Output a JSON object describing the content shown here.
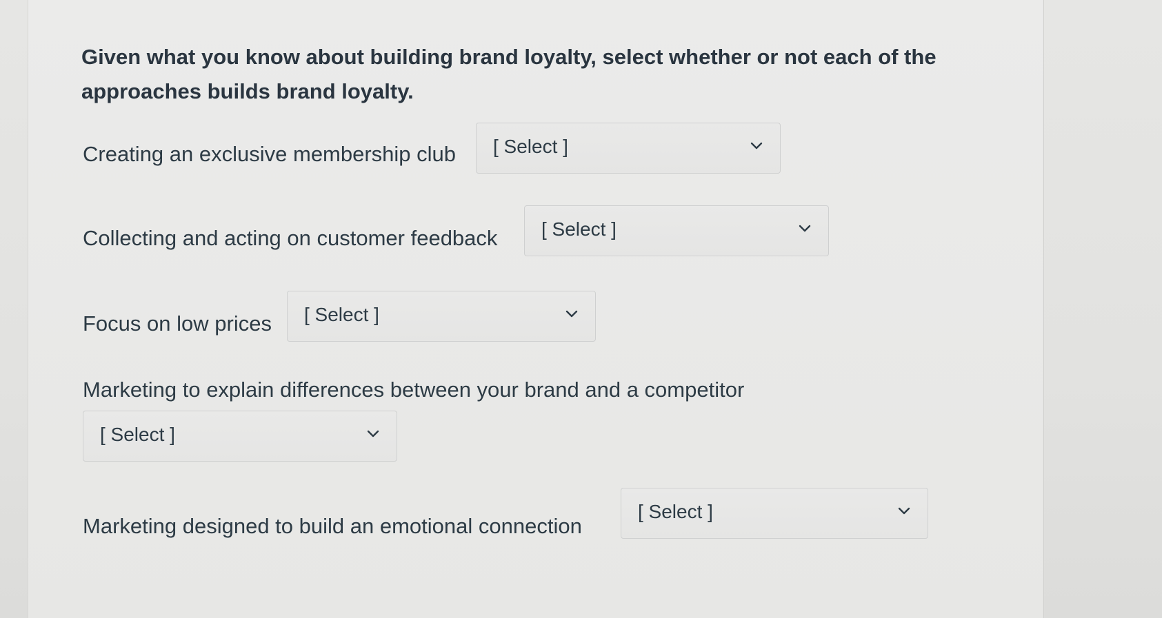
{
  "question": {
    "text": "Given what you know about building brand loyalty, select whether or not each of the approaches builds brand loyalty."
  },
  "items": [
    {
      "label": "Creating an exclusive membership club",
      "value": "[ Select ]"
    },
    {
      "label": "Collecting and acting on customer feedback",
      "value": "[ Select ]"
    },
    {
      "label": "Focus on low prices",
      "value": "[ Select ]"
    },
    {
      "label": "Marketing to explain differences between your brand and a competitor",
      "value": "[ Select ]"
    },
    {
      "label": "Marketing designed to build an emotional connection",
      "value": "[ Select ]"
    }
  ],
  "icons": {
    "dropdown": "chevron-down-icon"
  },
  "colors": {
    "text": "#2d3b45",
    "border": "#cfd0d0",
    "background": "#e7e7e5"
  }
}
